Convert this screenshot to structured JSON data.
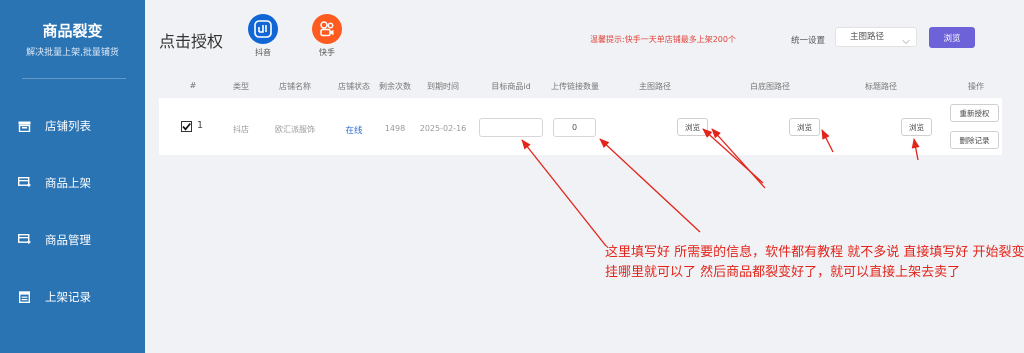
{
  "sidebar": {
    "brand": {
      "title": "商品裂变",
      "subtitle": "解决批量上架,批量铺货"
    },
    "items": [
      {
        "label": "店铺列表",
        "icon": "store-icon"
      },
      {
        "label": "商品上架",
        "icon": "product-upload-icon"
      },
      {
        "label": "商品管理",
        "icon": "product-manage-icon"
      },
      {
        "label": "上架记录",
        "icon": "record-icon"
      }
    ]
  },
  "header": {
    "title": "点击授权",
    "platforms": [
      {
        "label": "抖音",
        "color": "#1166d6",
        "icon": "douyin-icon"
      },
      {
        "label": "快手",
        "color": "#ff5a1f",
        "icon": "kuaishou-icon"
      }
    ],
    "tip": "温馨提示:快手一天单店铺最多上架200个",
    "unified_setting_label": "统一设置",
    "path_select_value": "主图路径",
    "browse_button": "浏览"
  },
  "table": {
    "columns": [
      "#",
      "类型",
      "店铺名称",
      "店铺状态",
      "剩余次数",
      "到期时间",
      "目标商品id",
      "上传链接数量",
      "主图路径",
      "白底图路径",
      "标题路径",
      "操作"
    ],
    "rows": [
      {
        "checked": true,
        "index": "1",
        "type": "抖店",
        "store_name": "欧汇派服饰",
        "status": "在线",
        "remaining": "1498",
        "expire": "2025-02-16",
        "target_product_id": "",
        "upload_count": "0",
        "browse_main": "浏览",
        "browse_white": "浏览",
        "browse_title": "浏览",
        "reauth": "重新授权",
        "delete_record": "删除记录"
      }
    ]
  },
  "annotation": "这里填写好 所需要的信息，软件都有教程 就不多说 直接填写好 开始裂变 挂哪里就可以了 然后商品都裂变好了，就可以直接上架去卖了",
  "colors": {
    "sidebar": "#2b74b4",
    "accent_button": "#6e62d8",
    "status_online": "#2f6fd6",
    "tip_text": "#e2443b",
    "annotation": "#e3241b"
  }
}
